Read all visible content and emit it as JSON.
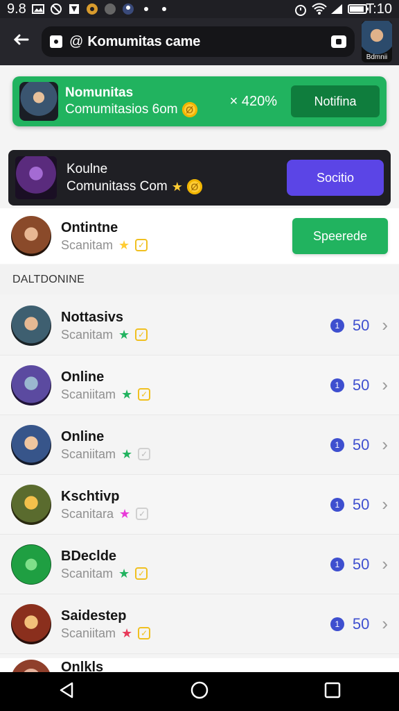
{
  "status_bar": {
    "left_time": "9.8",
    "right_time": "T:10"
  },
  "app_bar": {
    "address_title": "Komumitas came",
    "at_symbol": "@",
    "thumb_label": "Bdmnii"
  },
  "promo_green": {
    "title": "Nomunitas",
    "subtitle": "Comumitasios 6om",
    "percent": "× 420%",
    "button": "Notifina"
  },
  "promo_dark": {
    "title": "Koulne",
    "subtitle": "Comunitass Com",
    "button": "Socitio"
  },
  "featured_row": {
    "name": "Ontintne",
    "sub": "Scanitam",
    "button": "Speerede"
  },
  "section_title": "DALTDONINE",
  "items": [
    {
      "name": "Nottasivs",
      "sub": "Scanitam",
      "count": "50",
      "star_color": "#21b35f",
      "alt": false
    },
    {
      "name": "Online",
      "sub": "Scaniitam",
      "count": "50",
      "star_color": "#21b35f",
      "alt": true
    },
    {
      "name": "Online",
      "sub": "Scaniitam",
      "count": "50",
      "star_color": "#21b35f",
      "alt": false
    },
    {
      "name": "Kschtivp",
      "sub": "Scanitara",
      "count": "50",
      "star_color": "#e83ad8",
      "alt": true
    },
    {
      "name": "BDeclde",
      "sub": "Scanitam",
      "count": "50",
      "star_color": "#21b35f",
      "alt": false
    },
    {
      "name": "Saidestep",
      "sub": "Scaniitam",
      "count": "50",
      "star_color": "#e83a5a",
      "alt": false
    }
  ],
  "partial_item": {
    "name": "Onlkls"
  },
  "icons": {
    "back": "arrow-left-icon",
    "tabs": "tabs-icon",
    "coin": "coin-icon",
    "star": "star-icon",
    "check": "check-badge-icon",
    "token": "token-icon",
    "chevron": "chevron-right-icon"
  }
}
